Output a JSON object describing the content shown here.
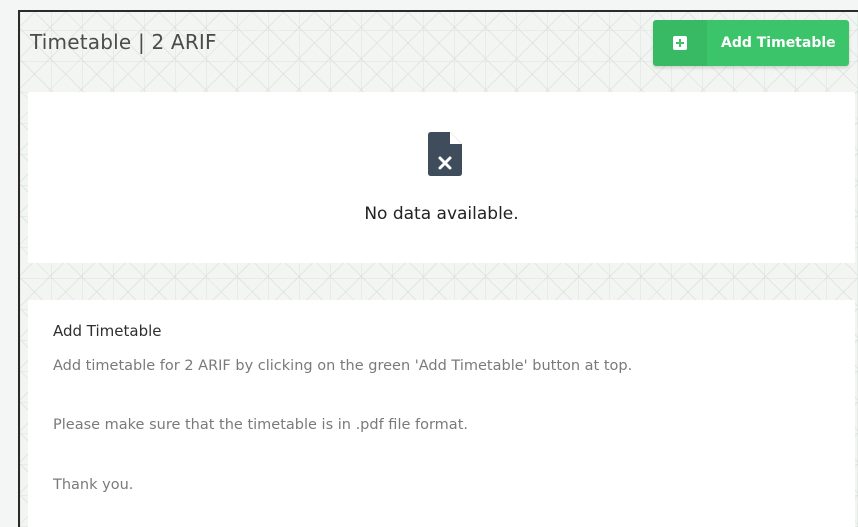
{
  "header": {
    "title": "Timetable | 2 ARIF",
    "add_button_label": "Add Timetable",
    "add_button_icon": "plus-square-icon"
  },
  "empty_state": {
    "icon": "file-x-icon",
    "message": "No data available."
  },
  "info": {
    "heading": "Add Timetable",
    "line1": "Add timetable for 2 ARIF by clicking on the green 'Add Timetable' button at top.",
    "line2": "Please make sure that the timetable is in .pdf file format.",
    "line3": "Thank you."
  },
  "colors": {
    "accent": "#3cc46b",
    "icon": "#3f4c5c"
  }
}
